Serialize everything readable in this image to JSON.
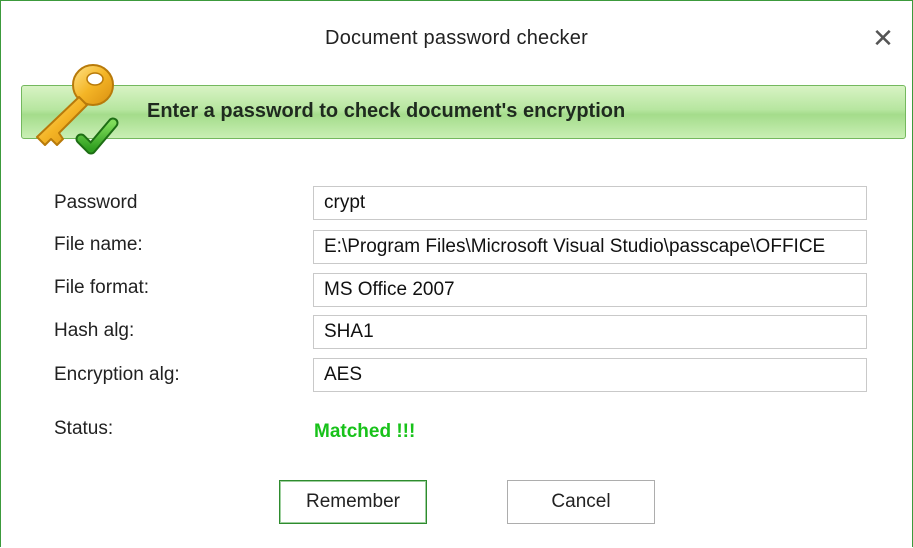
{
  "window": {
    "title": "Document password checker",
    "close_glyph": "✕"
  },
  "banner": {
    "text": "Enter a password to check document's encryption",
    "icon": "key-check-icon"
  },
  "form": {
    "password": {
      "label": "Password",
      "value": "crypt"
    },
    "file_name": {
      "label": "File name:",
      "value": "E:\\Program Files\\Microsoft Visual Studio\\passcape\\OFFICE"
    },
    "file_format": {
      "label": "File format:",
      "value": "MS Office 2007"
    },
    "hash_alg": {
      "label": "Hash alg:",
      "value": "SHA1"
    },
    "encryption_alg": {
      "label": "Encryption alg:",
      "value": "AES"
    },
    "status": {
      "label": "Status:",
      "value": "Matched !!!"
    }
  },
  "buttons": {
    "remember": "Remember",
    "cancel": "Cancel"
  },
  "colors": {
    "accent_green": "#18c21a",
    "banner_green": "#b7e6a0",
    "window_border": "#3c9a3c"
  }
}
